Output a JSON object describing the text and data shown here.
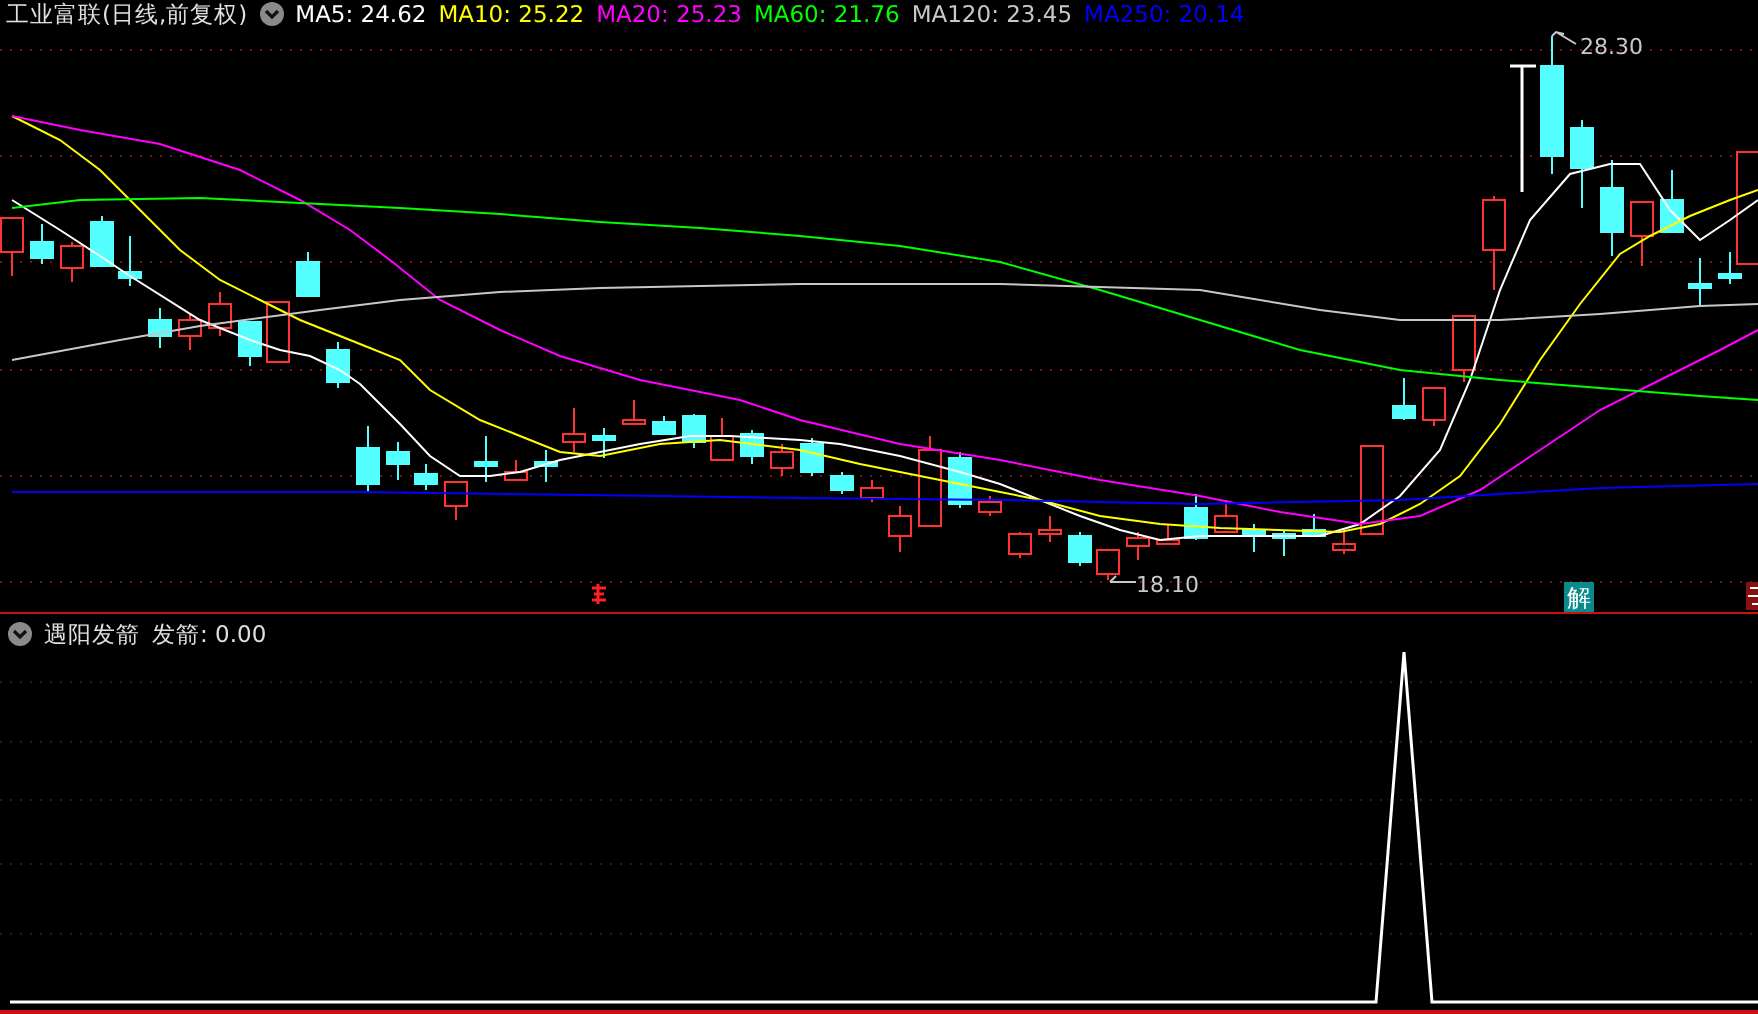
{
  "main_panel": {
    "title": "工业富联(日线,前复权)",
    "indicators": [
      {
        "label": "MA5:",
        "value": "24.62",
        "color": "#ffffff"
      },
      {
        "label": "MA10:",
        "value": "25.22",
        "color": "#ffff00"
      },
      {
        "label": "MA20:",
        "value": "25.23",
        "color": "#ff00ff"
      },
      {
        "label": "MA60:",
        "value": "21.76",
        "color": "#00ff00"
      },
      {
        "label": "MA120:",
        "value": "23.45",
        "color": "#c8c8c8"
      },
      {
        "label": "MA250:",
        "value": "20.14",
        "color": "#0000ff"
      }
    ],
    "high_label": "28.30",
    "low_label": "18.10",
    "badge": "解"
  },
  "lower_panel": {
    "title": "遇阳发箭",
    "indicator": {
      "label": "发箭:",
      "value": "0.00"
    }
  }
}
